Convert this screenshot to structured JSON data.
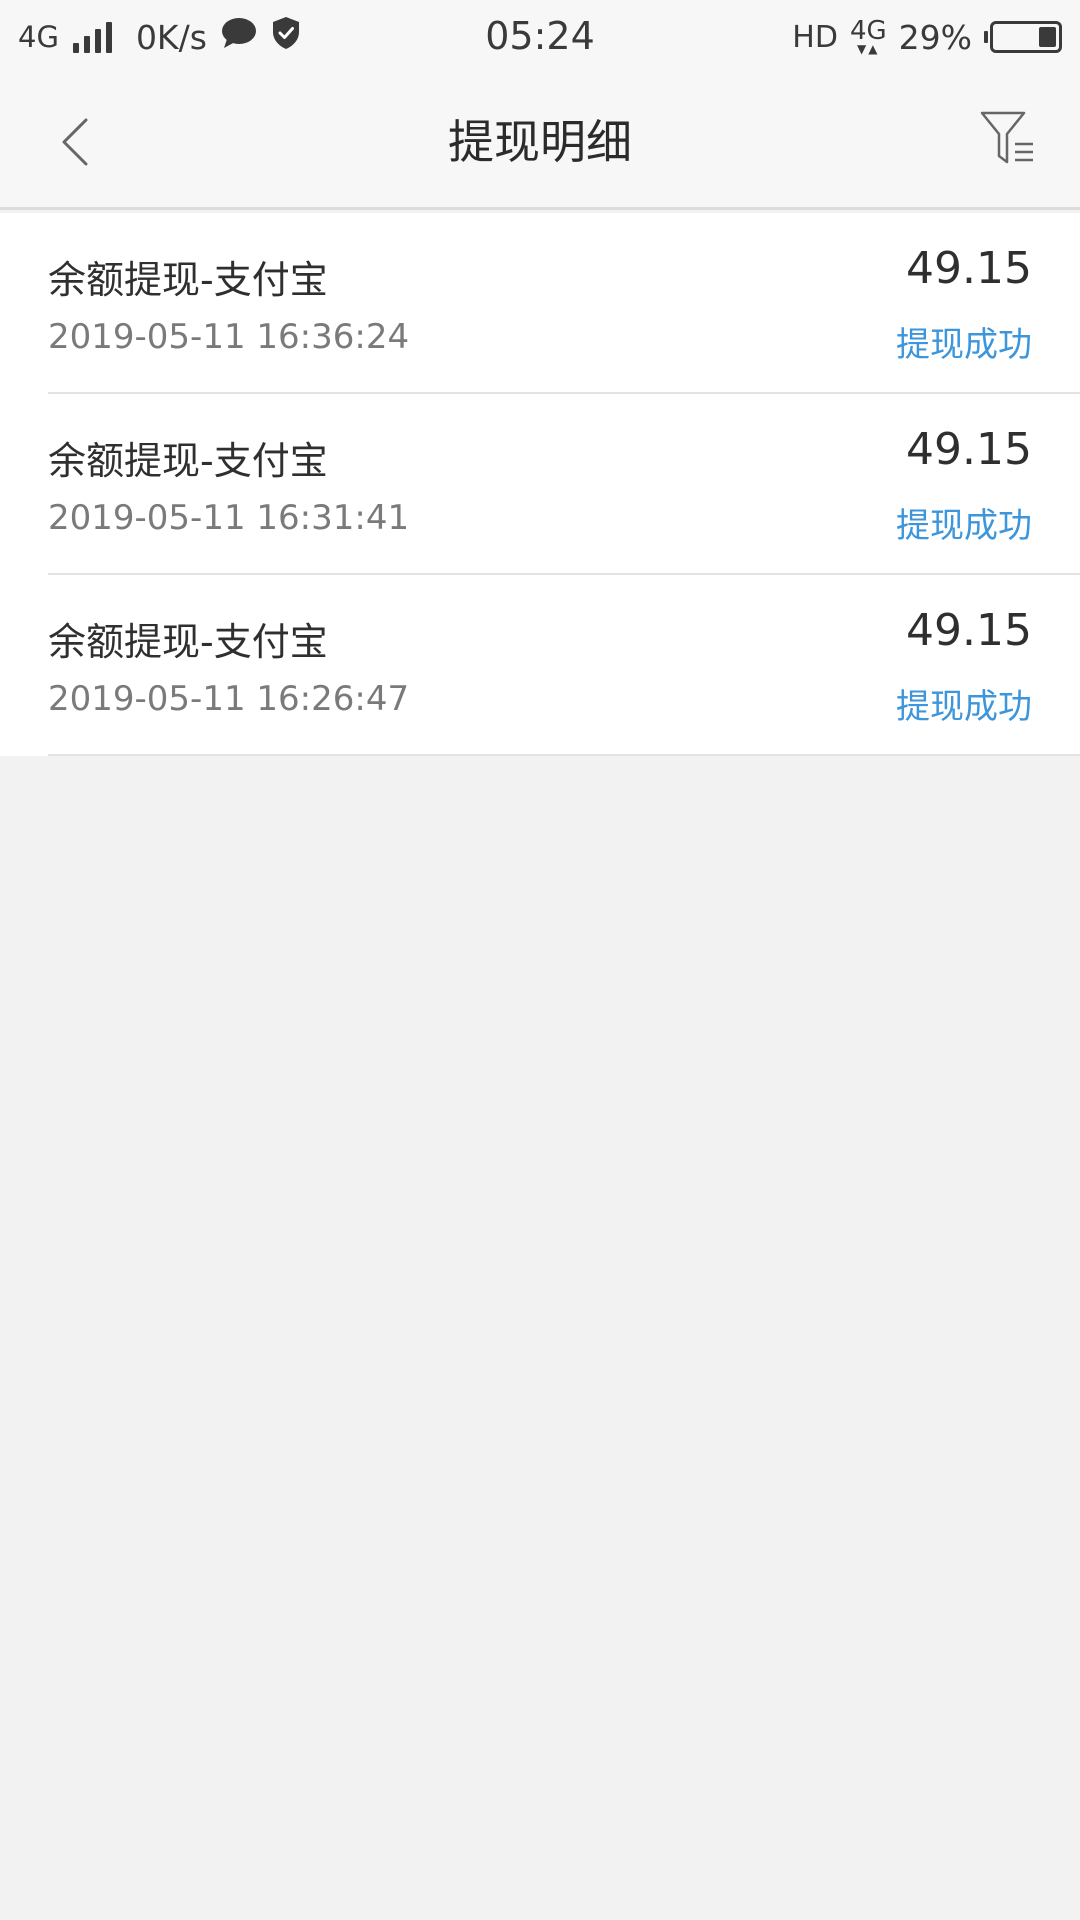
{
  "status_bar": {
    "network": "4G",
    "speed": "0K/s",
    "time": "05:24",
    "hd": "HD",
    "lte": "4G",
    "battery": "29%",
    "battery_level": 0.29
  },
  "header": {
    "title": "提现明细"
  },
  "records": [
    {
      "title": "余额提现-支付宝",
      "time": "2019-05-11 16:36:24",
      "amount": "49.15",
      "status": "提现成功"
    },
    {
      "title": "余额提现-支付宝",
      "time": "2019-05-11 16:31:41",
      "amount": "49.15",
      "status": "提现成功"
    },
    {
      "title": "余额提现-支付宝",
      "time": "2019-05-11 16:26:47",
      "amount": "49.15",
      "status": "提现成功"
    }
  ],
  "colors": {
    "status_success": "#3d96db",
    "page_background": "#f2f2f2",
    "list_background": "#ffffff"
  }
}
